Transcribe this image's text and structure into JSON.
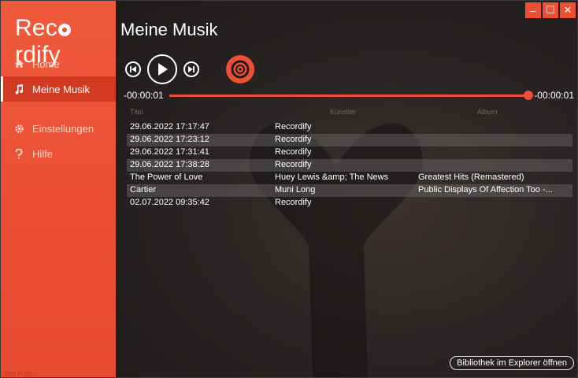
{
  "app": {
    "logo_text_a": "Rec",
    "logo_text_b": "rdify",
    "version": "2022 (7.07)"
  },
  "sidebar": {
    "items": [
      {
        "label": "Home",
        "icon": "home-icon"
      },
      {
        "label": "Meine Musik",
        "icon": "music-note-icon",
        "active": true
      },
      {
        "label": "Einstellungen",
        "icon": "gear-icon"
      },
      {
        "label": "Hilfe",
        "icon": "question-icon"
      }
    ]
  },
  "main": {
    "title": "Meine Musik",
    "time_elapsed": "-00:00:01",
    "time_remaining": "-00:00:01",
    "progress": 1.0,
    "columns": {
      "title": "Titel",
      "artist": "Künstler",
      "album": "Album"
    },
    "tracks": [
      {
        "title": "29.06.2022 17:17:47",
        "artist": "Recordify",
        "album": ""
      },
      {
        "title": "29.06.2022 17:23:12",
        "artist": "Recordify",
        "album": ""
      },
      {
        "title": "29.06.2022 17:31:41",
        "artist": "Recordify",
        "album": ""
      },
      {
        "title": "29.06.2022 17:38:28",
        "artist": "Recordify",
        "album": ""
      },
      {
        "title": "The Power of Love",
        "artist": "Huey Lewis &amp; The News",
        "album": "Greatest Hits (Remastered)"
      },
      {
        "title": "Cartier",
        "artist": "Muni Long",
        "album": "Public Displays Of Affection Too -..."
      },
      {
        "title": "02.07.2022 09:35:42",
        "artist": "Recordify",
        "album": ""
      }
    ],
    "open_library_label": "Bibliothek im Explorer öffnen"
  },
  "colors": {
    "accent": "#ec4f34",
    "active": "#d23b22"
  }
}
